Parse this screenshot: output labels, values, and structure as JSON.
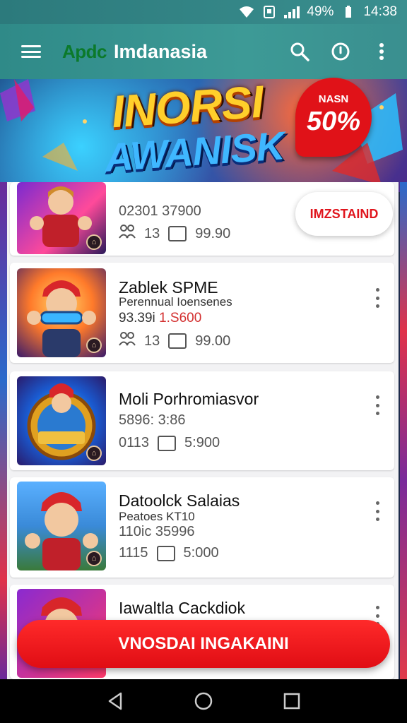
{
  "status_bar": {
    "battery": "49%",
    "time": "14:38"
  },
  "app_bar": {
    "logo": "Apdc",
    "title": "Imdanasia"
  },
  "banner": {
    "title_line1": "INORSI",
    "title_line2": "AWANISK",
    "badge_small": "NASN",
    "badge_big": "50%"
  },
  "list": {
    "items": [
      {
        "title": "",
        "line1": "02301 37900",
        "meta_a": "13",
        "meta_b": "99.90",
        "action_label": "IMZSTAIND"
      },
      {
        "title": "Zablek SPME",
        "sub": "Perennual Ioensenes",
        "sub2_a": "93.39i",
        "sub2_b": "1.S600",
        "meta_a": "13",
        "meta_b": "99.00"
      },
      {
        "title": "Moli Porhromiasvor",
        "line1": "5896: 3:86",
        "meta_a": "0113",
        "meta_b": "5:900"
      },
      {
        "title": "Datoolck Salaias",
        "sub": "Peatoes     KT10",
        "line1": "110ic 35996",
        "meta_a": "1115",
        "meta_b": "5:000"
      },
      {
        "title": "Iawaltla Cackdiok"
      }
    ]
  },
  "cta": {
    "label": "VNOSDAI INGAKAINI"
  }
}
